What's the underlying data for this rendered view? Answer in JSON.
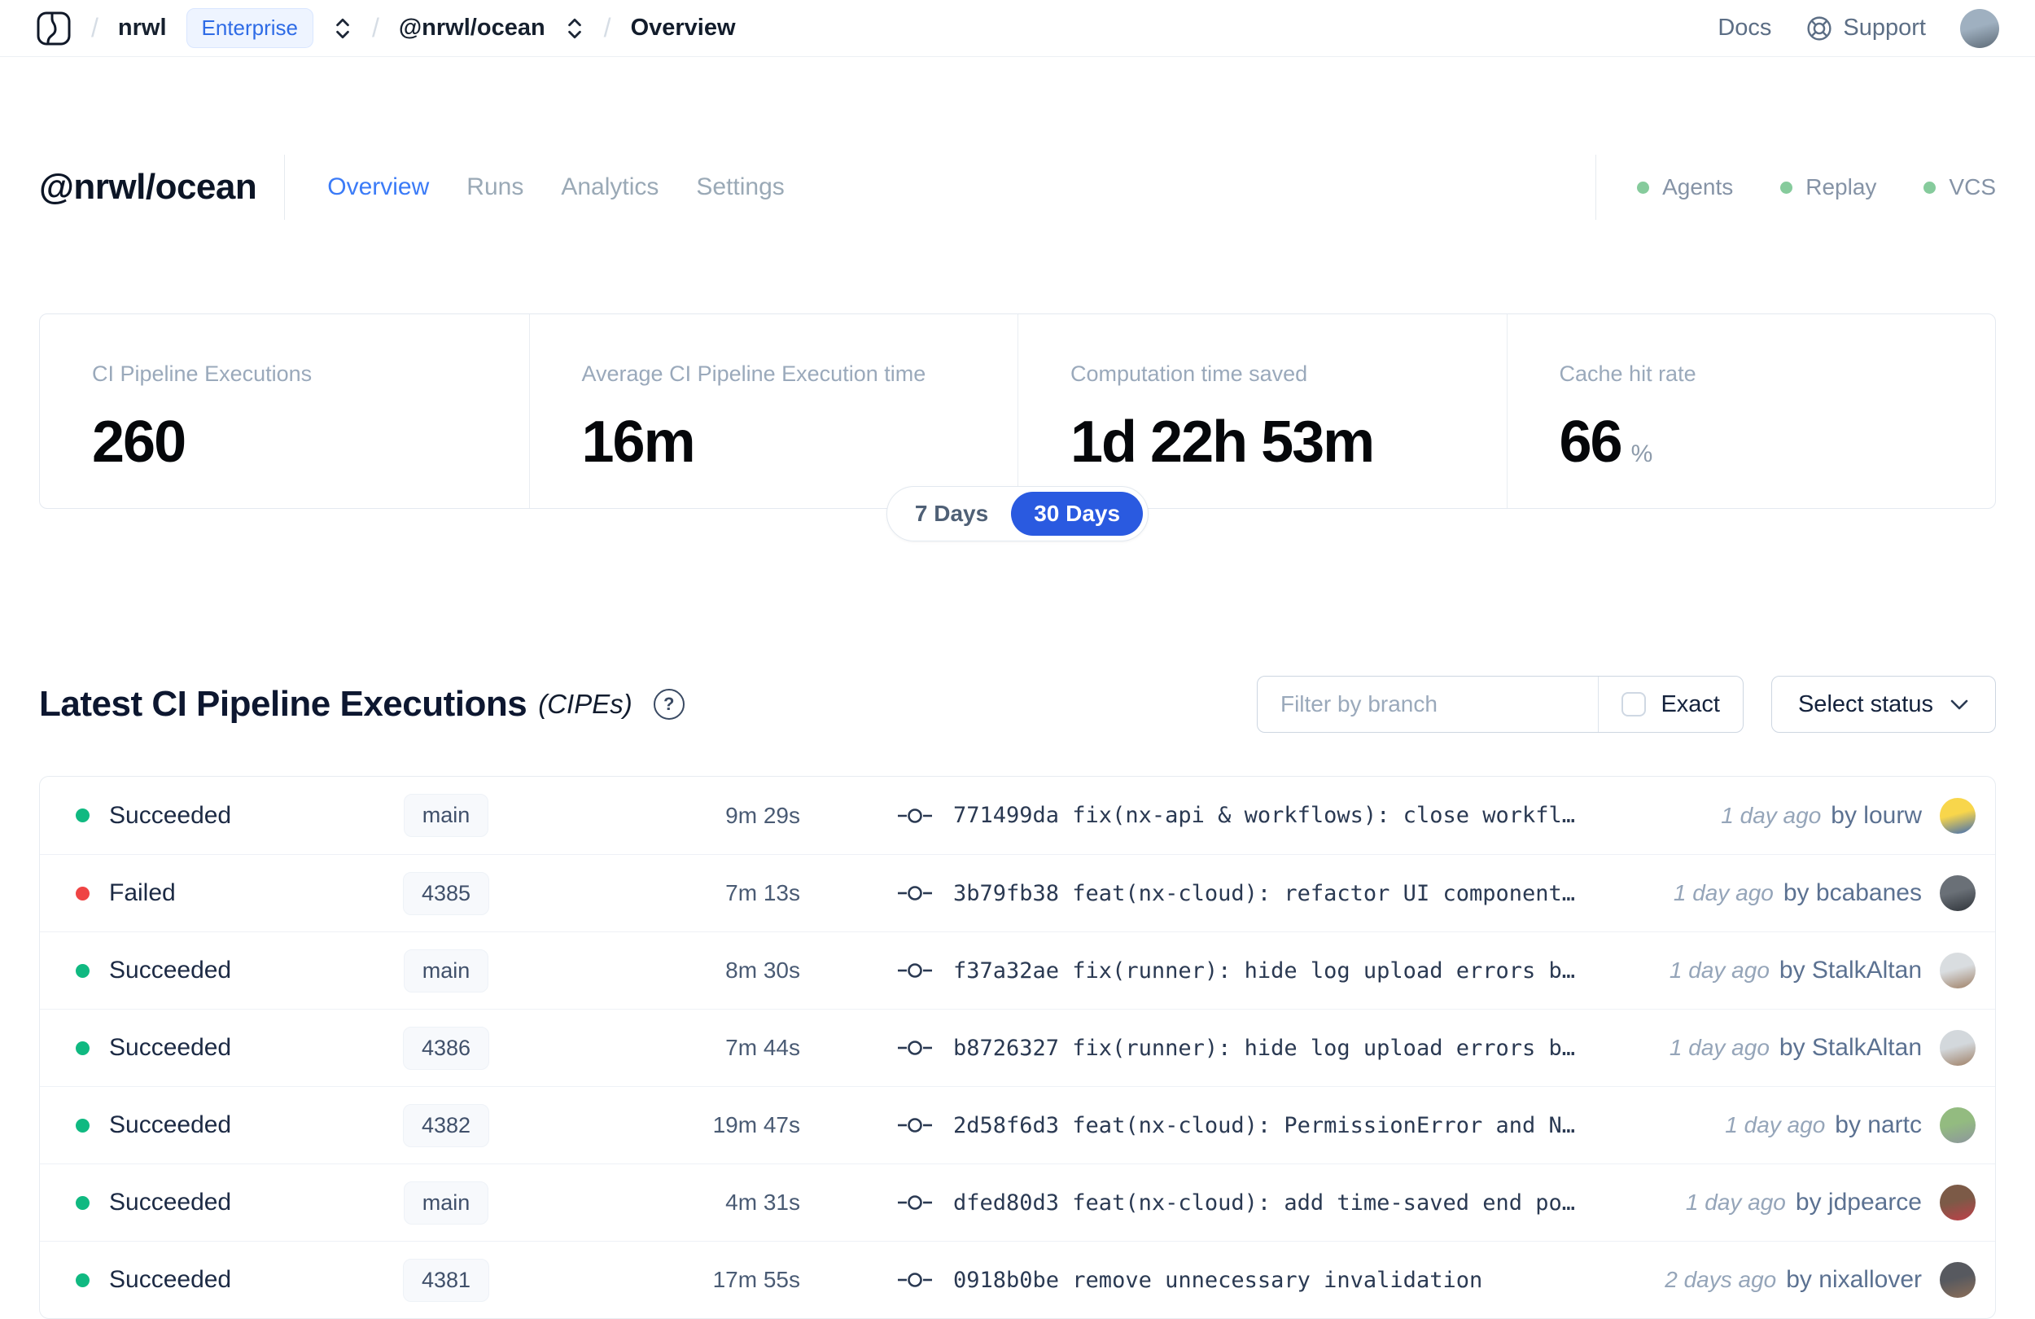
{
  "colors": {
    "accent_blue": "#2a5ae0",
    "tab_active_blue": "#3b7bf7",
    "succeeded_green": "#10b981",
    "failed_red": "#ef4444",
    "feature_dot_green": "#86cb9c"
  },
  "topbar": {
    "separator": "/",
    "org": "nrwl",
    "enterprise_badge": "Enterprise",
    "workspace": "@nrwl/ocean",
    "page": "Overview",
    "docs": "Docs",
    "support": "Support",
    "avatar_colors": [
      "#9fb0c0",
      "#5d6a76"
    ]
  },
  "workspace_header": {
    "title": "@nrwl/ocean",
    "tabs": [
      {
        "label": "Overview"
      },
      {
        "label": "Runs"
      },
      {
        "label": "Analytics"
      },
      {
        "label": "Settings"
      }
    ],
    "features": [
      {
        "label": "Agents"
      },
      {
        "label": "Replay"
      },
      {
        "label": "VCS"
      }
    ]
  },
  "stats": {
    "cards": [
      {
        "label": "CI Pipeline Executions",
        "value": "260",
        "suffix": ""
      },
      {
        "label": "Average CI Pipeline Execution time",
        "value": "16m",
        "suffix": ""
      },
      {
        "label": "Computation time saved",
        "value": "1d 22h 53m",
        "suffix": ""
      },
      {
        "label": "Cache hit rate",
        "value": "66",
        "suffix": "%"
      }
    ],
    "range": {
      "options": [
        "7 Days",
        "30 Days"
      ],
      "selected": "30 Days"
    }
  },
  "cipe": {
    "title": "Latest CI Pipeline Executions",
    "subtitle": "(CIPEs)",
    "help_glyph": "?",
    "filter_placeholder": "Filter by branch",
    "exact_label": "Exact",
    "select_status": "Select status",
    "rows": [
      {
        "status": "Succeeded",
        "dot": "#10b981",
        "branch": "main",
        "duration": "9m 29s",
        "commit": "771499da fix(nx-api & workflows): close workfl…",
        "ago": "1 day ago",
        "byline": "by lourw",
        "avatar": [
          "#f8d64b",
          "#3f6cb4"
        ]
      },
      {
        "status": "Failed",
        "dot": "#ef4444",
        "branch": "4385",
        "duration": "7m 13s",
        "commit": "3b79fb38 feat(nx-cloud): refactor UI component…",
        "ago": "1 day ago",
        "byline": "by bcabanes",
        "avatar": [
          "#6a7077",
          "#30353b"
        ]
      },
      {
        "status": "Succeeded",
        "dot": "#10b981",
        "branch": "main",
        "duration": "8m 30s",
        "commit": "f37a32ae fix(runner): hide log upload errors b…",
        "ago": "1 day ago",
        "byline": "by StalkAltan",
        "avatar": [
          "#d9dde0",
          "#9f8066"
        ]
      },
      {
        "status": "Succeeded",
        "dot": "#10b981",
        "branch": "4386",
        "duration": "7m 44s",
        "commit": "b8726327 fix(runner): hide log upload errors b…",
        "ago": "1 day ago",
        "byline": "by StalkAltan",
        "avatar": [
          "#d3d8dc",
          "#9f8066"
        ]
      },
      {
        "status": "Succeeded",
        "dot": "#10b981",
        "branch": "4382",
        "duration": "19m 47s",
        "commit": "2d58f6d3 feat(nx-cloud): PermissionError and N…",
        "ago": "1 day ago",
        "byline": "by nartc",
        "avatar": [
          "#93bb80",
          "#8d969d"
        ]
      },
      {
        "status": "Succeeded",
        "dot": "#10b981",
        "branch": "main",
        "duration": "4m 31s",
        "commit": "dfed80d3 feat(nx-cloud): add time-saved end po…",
        "ago": "1 day ago",
        "byline": "by jdpearce",
        "avatar": [
          "#7c5a47",
          "#bf4049"
        ]
      },
      {
        "status": "Succeeded",
        "dot": "#10b981",
        "branch": "4381",
        "duration": "17m 55s",
        "commit": "0918b0be remove unnecessary invalidation",
        "ago": "2 days ago",
        "byline": "by nixallover",
        "avatar": [
          "#57595f",
          "#8c6e58"
        ]
      }
    ]
  }
}
